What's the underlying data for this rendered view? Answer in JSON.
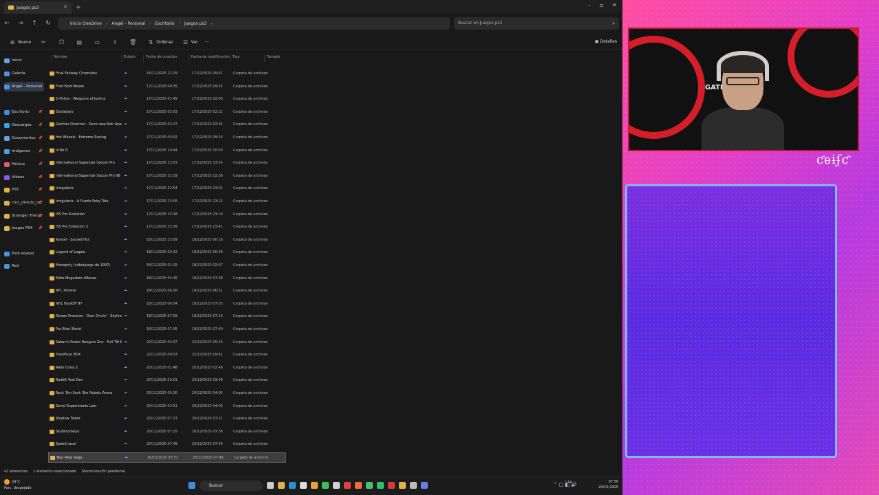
{
  "window": {
    "tab_title": "Juegos ps3"
  },
  "address": {
    "crumbs": [
      "Inicio OneDrive",
      "Angel - Personal",
      "Escritorio",
      "Juegos ps3"
    ],
    "search_placeholder": "Buscar en Juegos ps3"
  },
  "toolbar": {
    "new_label": "Nuevo",
    "sort_label": "Ordenar",
    "view_label": "Ver",
    "more_label": "···",
    "details_label": "Detalles"
  },
  "sidebar": {
    "items": [
      {
        "label": "Inicio",
        "color": "#6aa0e6"
      },
      {
        "label": "Galería",
        "color": "#4a90e2"
      },
      {
        "label": "Angel - Personal",
        "color": "#4a90e2"
      },
      {
        "label": "Escritorio",
        "color": "#3a8ee6"
      },
      {
        "label": "Descargas",
        "color": "#3aa0e6"
      },
      {
        "label": "Documentos",
        "color": "#6aa0e6"
      },
      {
        "label": "Imágenes",
        "color": "#4aa0e6"
      },
      {
        "label": "Música",
        "color": "#e05a7a"
      },
      {
        "label": "Vídeos",
        "color": "#8a5ae6"
      },
      {
        "label": "PS5",
        "color": "#e2b04a"
      },
      {
        "label": "cmc_directo_rec",
        "color": "#e2b04a"
      },
      {
        "label": "Stranger Things",
        "color": "#e2b04a"
      },
      {
        "label": "Juegos PS4",
        "color": "#e2b04a"
      },
      {
        "label": "Este equipo",
        "color": "#4a90e2"
      },
      {
        "label": "Red",
        "color": "#4a90e2"
      }
    ]
  },
  "columns": {
    "name": "Nombre",
    "status": "Estado",
    "created": "Fecha de creación",
    "modified": "Fecha de modificación",
    "type": "Tipo",
    "size": "Tamaño"
  },
  "files": [
    {
      "name": "Final Fantasy Chronicles",
      "created": "16/12/2025 22:29",
      "modified": "17/12/2025 09:41",
      "type": "Carpeta de archivos"
    },
    {
      "name": "Ford Bold Moves",
      "created": "17/12/2025 00:35",
      "modified": "17/12/2025 09:55",
      "type": "Carpeta de archivos"
    },
    {
      "name": "G-Police - Weapons of Justice",
      "created": "17/12/2025 01:49",
      "modified": "17/12/2025 02:00",
      "type": "Carpeta de archivos"
    },
    {
      "name": "Gladiators",
      "created": "17/12/2025 02:03",
      "modified": "17/12/2025 02:22",
      "type": "Carpeta de archivos"
    },
    {
      "name": "Gekitou Overrrun - Kuno rase Kati Ayashi...",
      "created": "17/12/2025 02:27",
      "modified": "17/12/2025 02:34",
      "type": "Carpeta de archivos"
    },
    {
      "name": "Hot Wheels - Extreme Racing",
      "created": "17/12/2025 03:02",
      "modified": "17/12/2025 09:33",
      "type": "Carpeta de archivos"
    },
    {
      "name": "In'do D",
      "created": "17/12/2025 10:44",
      "modified": "17/12/2025 10:50",
      "type": "Carpeta de archivos"
    },
    {
      "name": "International Superstar Soccer Pro",
      "created": "17/12/2025 13:53",
      "modified": "17/12/2025 13:55",
      "type": "Carpeta de archivos"
    },
    {
      "name": "International Superstar Soccer Pro 98",
      "created": "17/12/2025 22:19",
      "modified": "17/12/2025 22:38",
      "type": "Carpeta de archivos"
    },
    {
      "name": "Irregularia",
      "created": "17/12/2025 22:54",
      "modified": "17/12/2025 23:01",
      "type": "Carpeta de archivos"
    },
    {
      "name": "Irregularia - A Puzzle Fairy Tale",
      "created": "17/12/2025 23:05",
      "modified": "17/12/2025 23:12",
      "type": "Carpeta de archivos"
    },
    {
      "name": "ISS Pro Evolution",
      "created": "17/12/2025 23:18",
      "modified": "17/12/2025 23:19",
      "type": "Carpeta de archivos"
    },
    {
      "name": "ISS Pro Evolution 2",
      "created": "17/12/2025 23:39",
      "modified": "17/12/2025 23:41",
      "type": "Carpeta de archivos"
    },
    {
      "name": "Kensei - Sacred Fist",
      "created": "18/12/2025 23:09",
      "modified": "18/12/2025 00:18",
      "type": "Carpeta de archivos"
    },
    {
      "name": "Legend of Legaia",
      "created": "18/12/2025 00:32",
      "modified": "18/12/2025 00:39",
      "type": "Carpeta de archivos"
    },
    {
      "name": "Monopoly (videojuego de 1997)",
      "created": "18/12/2025 01:15",
      "modified": "18/12/2025 02:07",
      "type": "Carpeta de archivos"
    },
    {
      "name": "Moto Megadore Aflacao",
      "created": "18/12/2025 04:45",
      "modified": "18/12/2025 07:38",
      "type": "Carpeta de archivos"
    },
    {
      "name": "NFL Xtreme",
      "created": "18/12/2025 06:28",
      "modified": "18/12/2025 06:51",
      "type": "Carpeta de archivos"
    },
    {
      "name": "NHL FaceOff 97",
      "created": "18/12/2025 06:54",
      "modified": "18/12/2025 07:03",
      "type": "Carpeta de archivos"
    },
    {
      "name": "Nissan Presents - Over Drivin' - Skyline ...",
      "created": "18/12/2025 07:09",
      "modified": "18/12/2025 07:16",
      "type": "Carpeta de archivos"
    },
    {
      "name": "Pac-Man World",
      "created": "18/12/2025 07:35",
      "modified": "18/12/2025 07:40",
      "type": "Carpeta de archivos"
    },
    {
      "name": "Saban's Power Rangers Zeo - Full Tilt Bat...",
      "created": "22/12/2025 04:07",
      "modified": "22/12/2025 05:13",
      "type": "Carpeta de archivos"
    },
    {
      "name": "PuyoPuyo BOX",
      "created": "22/12/2025 09:53",
      "modified": "22/12/2025 09:41",
      "type": "Carpeta de archivos"
    },
    {
      "name": "Rally Cross 2",
      "created": "20/12/2025 01:48",
      "modified": "20/12/2025 02:48",
      "type": "Carpeta de archivos"
    },
    {
      "name": "Reddit Yeet Dev",
      "created": "20/12/2025 03:01",
      "modified": "20/12/2025 03:48",
      "type": "Carpeta de archivos"
    },
    {
      "name": "Rock 'Em Sock 'Em Robots Arena",
      "created": "20/12/2025 03:30",
      "modified": "20/12/2025 04:05",
      "type": "Carpeta de archivos"
    },
    {
      "name": "Serial Experiments Lain",
      "created": "20/12/2025 03:51",
      "modified": "20/12/2025 04:03",
      "type": "Carpeta de archivos"
    },
    {
      "name": "Shadow Tower",
      "created": "20/12/2025 07:13",
      "modified": "20/12/2025 07:21",
      "type": "Carpeta de archivos"
    },
    {
      "name": "Skullmonkeys",
      "created": "20/12/2025 07:25",
      "modified": "20/12/2025 07:36",
      "type": "Carpeta de archivos"
    },
    {
      "name": "Speed racer",
      "created": "20/12/2025 07:49",
      "modified": "20/12/2025 07:49",
      "type": "Carpeta de archivos"
    },
    {
      "name": "Tear Ring Saga",
      "created": "20/12/2025 07:51",
      "modified": "20/12/2025 07:49",
      "type": "Carpeta de archivos"
    }
  ],
  "status": {
    "count": "42 elementos",
    "selected": "1 elemento seleccionado",
    "sync": "Sincronización pendiente"
  },
  "taskbar": {
    "weather_temp": "29°C",
    "weather_desc": "Parc. despejado",
    "search_label": "Buscar",
    "lang": "LAA",
    "time": "07:50",
    "date": "20/12/2025"
  },
  "stream": {
    "handle": "ƈѳɨʄƈ",
    "brand": "GATE CAL"
  }
}
